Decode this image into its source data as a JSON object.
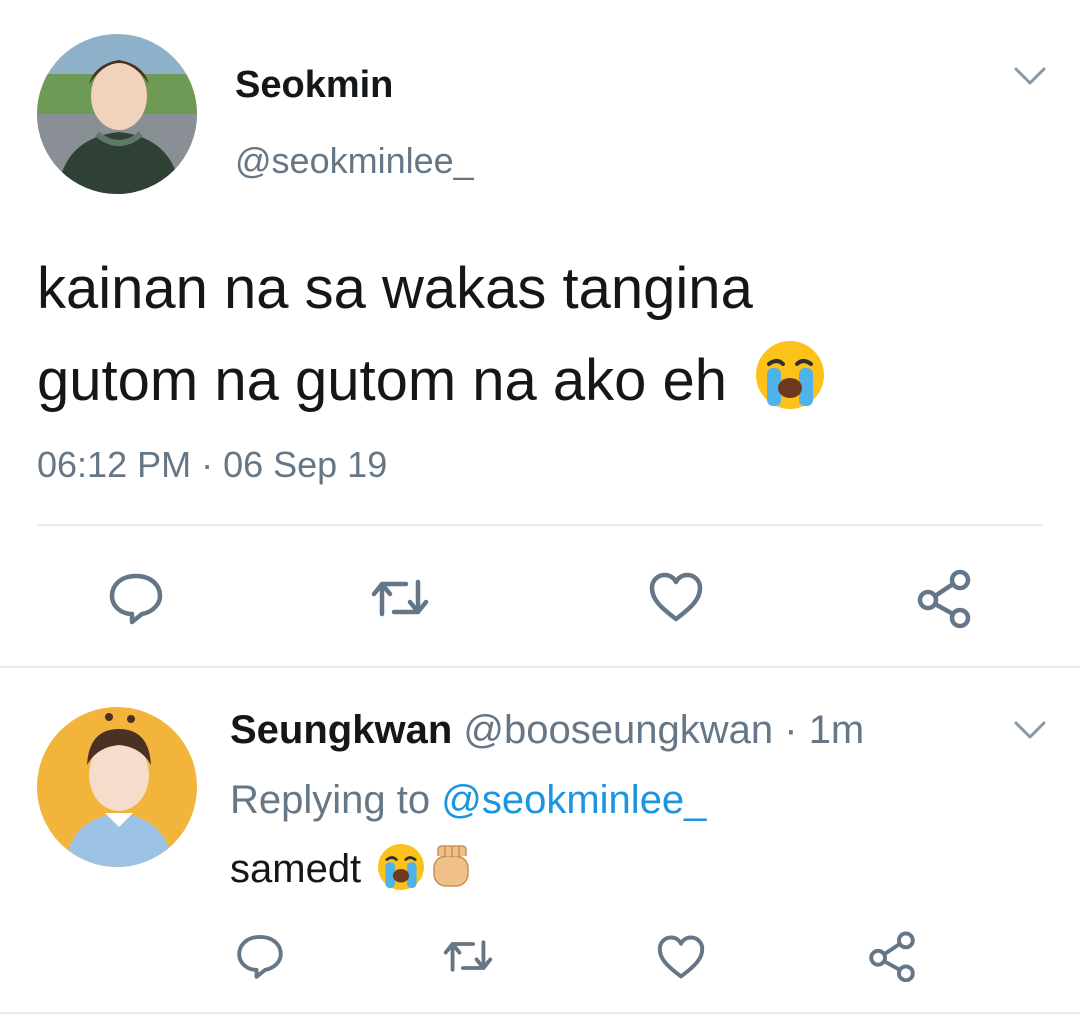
{
  "main_tweet": {
    "display_name": "Seokmin",
    "handle": "@seokminlee_",
    "text_line1": "kainan na sa wakas tangina",
    "text_line2": "gutom na gutom na ako eh",
    "timestamp": "06:12 PM · 06 Sep 19",
    "emoji": "loudly-crying-face"
  },
  "reply": {
    "display_name": "Seungkwan",
    "handle": "@booseungkwan",
    "separator": "·",
    "time": "1m",
    "replying_prefix": "Replying to",
    "replying_to": "@seokminlee_",
    "text": "samedt",
    "emojis": [
      "loudly-crying-face",
      "raised-fist"
    ]
  },
  "actions": [
    "reply-icon",
    "retweet-icon",
    "like-icon",
    "share-icon"
  ],
  "colors": {
    "text": "#14171a",
    "muted": "#657786",
    "link": "#1b95e0",
    "divider": "#e6ecf0",
    "icon": "#657786"
  }
}
